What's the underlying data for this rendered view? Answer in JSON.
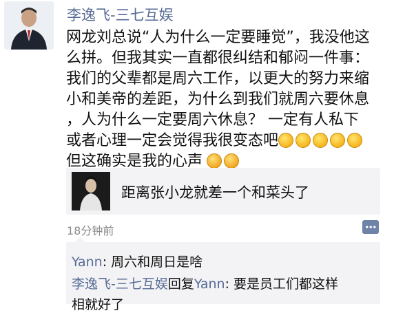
{
  "post": {
    "author": "李逸飞-三七互娱",
    "lines": [
      "网龙刘总说“人为什么一定要睡觉”，我没他这",
      "么拼。但我其实一直都很纠结和郁闷一件事：",
      "我们的父辈都是周六工作，以更大的努力来缩",
      "小和美帝的差距，为什么到我们就周六要休息",
      "，人为什么一定要周六休息？  一定有人私下",
      "或者心理一定会觉得我很变态吧",
      "但这确实是我的心声"
    ],
    "timestamp": "18分钟前"
  },
  "share": {
    "title": "距离张小龙就差一个和菜头了"
  },
  "comments": {
    "c1_user": "Yann",
    "c1_sep": ": ",
    "c1_text": "周六和周日是啥",
    "c2_user": "李逸飞-三七互娱",
    "c2_reply": "回复",
    "c2_target": "Yann",
    "c2_sep": ": ",
    "c2_text": "要是员工们都这样",
    "c3_text": "相就好了"
  },
  "icons": {
    "laugh_emoji": "grinning-squint-emoji",
    "shy_emoji": "shy-face-emoji",
    "comment_button": "comment-dots-icon"
  },
  "colors": {
    "name_link": "#576b95",
    "panel_bg": "#f3f3f5",
    "timestamp": "#8a8a8a"
  }
}
